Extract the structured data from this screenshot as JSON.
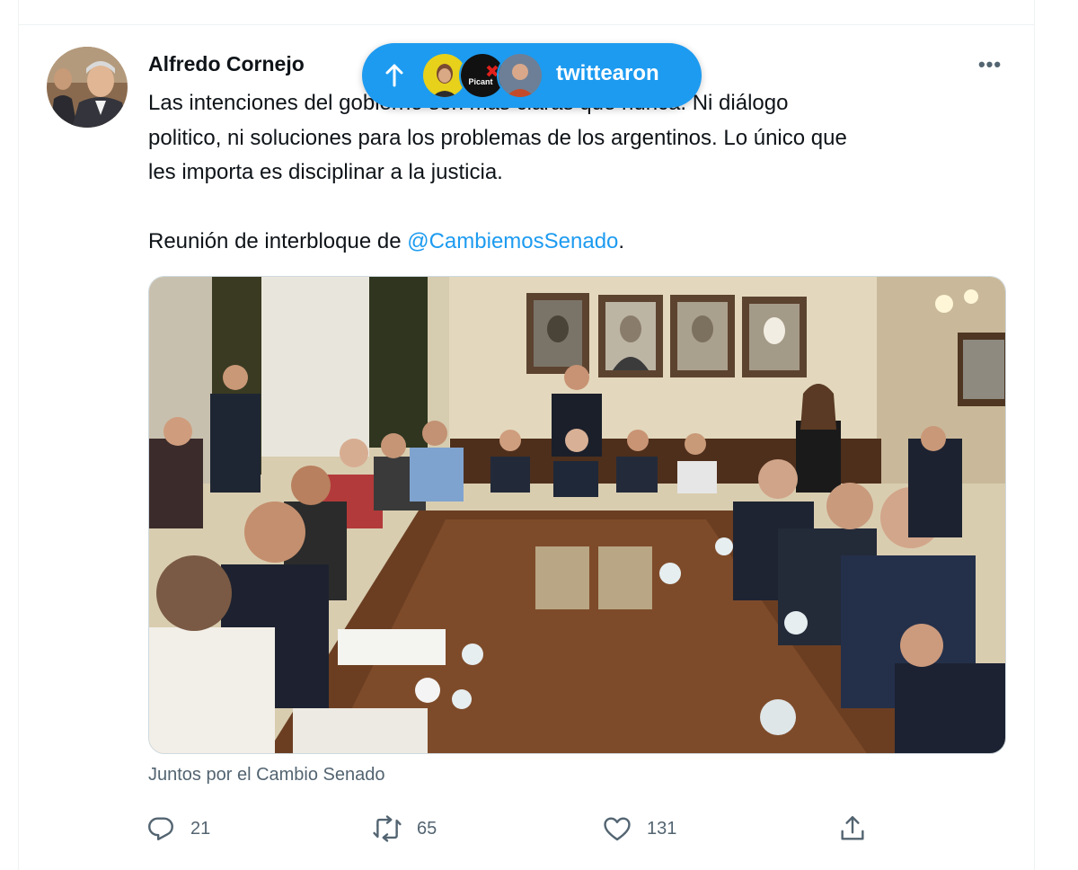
{
  "tweet": {
    "author_name": "Alfredo Cornejo",
    "text_lines": [
      "Las intenciones del gobierno son más claras que nunca. Ni diálogo",
      "politico, ni soluciones para los problemas de los argentinos. Lo único que",
      "les importa es disciplinar a la justicia."
    ],
    "text_last_prefix": "Reunión de interbloque de ",
    "mention": "@CambiemosSenado",
    "text_last_suffix": ".",
    "media_caption": "Juntos por el Cambio Senado"
  },
  "new_tweets_pill": {
    "label": "twittearon",
    "icon": "arrow-up-icon",
    "avatar_badge_text": "Picant"
  },
  "actions": {
    "reply_count": "21",
    "retweet_count": "65",
    "like_count": "131"
  },
  "colors": {
    "accent": "#1d9bf0",
    "text": "#0f1419",
    "secondary": "#536471",
    "border": "#eff3f4"
  }
}
